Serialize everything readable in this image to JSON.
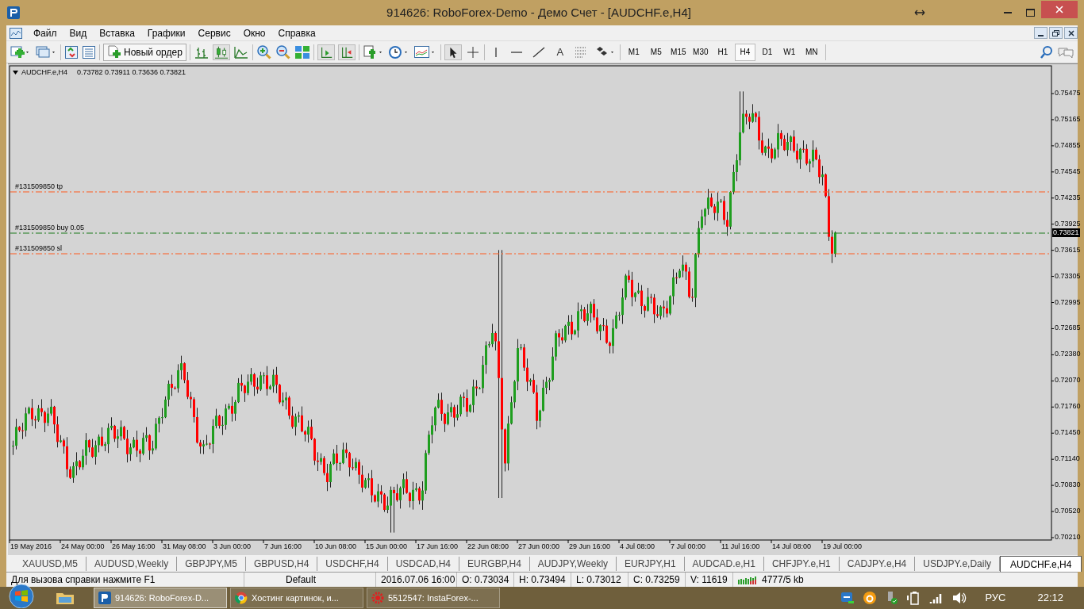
{
  "window": {
    "title": "914626: RoboForex-Demo - Демо Счет - [AUDCHF.e,H4]"
  },
  "menu": [
    "Файл",
    "Вид",
    "Вставка",
    "Графики",
    "Сервис",
    "Окно",
    "Справка"
  ],
  "toolbar": {
    "new_order": "Новый ордер",
    "text_tool": "A",
    "timeframes": [
      {
        "label": "M1",
        "selected": false
      },
      {
        "label": "M5",
        "selected": false
      },
      {
        "label": "M15",
        "selected": false
      },
      {
        "label": "M30",
        "selected": false
      },
      {
        "label": "H1",
        "selected": false
      },
      {
        "label": "H4",
        "selected": true
      },
      {
        "label": "D1",
        "selected": false
      },
      {
        "label": "W1",
        "selected": false
      },
      {
        "label": "MN",
        "selected": false
      }
    ]
  },
  "chart": {
    "symbol": "AUDCHF.e,H4",
    "ohlc": "0.73782 0.73911 0.73636 0.73821",
    "order_lines": [
      {
        "kind": "tp",
        "label": "#131509850 tp"
      },
      {
        "kind": "buy",
        "label": "#131509850 buy 0.05"
      },
      {
        "kind": "sl",
        "label": "#131509850 sl"
      }
    ],
    "price_axis": [
      "0.75475",
      "0.75165",
      "0.74855",
      "0.74545",
      "0.74235",
      "0.73925",
      "0.73615",
      "0.73305",
      "0.72995",
      "0.72685",
      "0.72380",
      "0.72070",
      "0.71760",
      "0.71450",
      "0.71140",
      "0.70830",
      "0.70520",
      "0.70210"
    ],
    "current_price": "0.73821",
    "time_axis": [
      "19 May 2016",
      "24 May 00:00",
      "26 May 16:00",
      "31 May 08:00",
      "3 Jun 00:00",
      "7 Jun 16:00",
      "10 Jun 08:00",
      "15 Jun 00:00",
      "17 Jun 16:00",
      "22 Jun 08:00",
      "27 Jun 00:00",
      "29 Jun 16:00",
      "4 Jul 08:00",
      "7 Jul 00:00",
      "11 Jul 16:00",
      "14 Jul 08:00",
      "19 Jul 00:00"
    ]
  },
  "tabs": [
    {
      "label": "XAUUSD,M5",
      "selected": false
    },
    {
      "label": "AUDUSD,Weekly",
      "selected": false
    },
    {
      "label": "GBPJPY,M5",
      "selected": false
    },
    {
      "label": "GBPUSD,H4",
      "selected": false
    },
    {
      "label": "USDCHF,H4",
      "selected": false
    },
    {
      "label": "USDCAD,H4",
      "selected": false
    },
    {
      "label": "EURGBP,H4",
      "selected": false
    },
    {
      "label": "AUDJPY,Weekly",
      "selected": false
    },
    {
      "label": "EURJPY,H1",
      "selected": false
    },
    {
      "label": "AUDCAD.e,H1",
      "selected": false
    },
    {
      "label": "CHFJPY.e,H1",
      "selected": false
    },
    {
      "label": "CADJPY.e,H4",
      "selected": false
    },
    {
      "label": "USDJPY.e,Daily",
      "selected": false
    },
    {
      "label": "AUDCHF.e,H4",
      "selected": true
    }
  ],
  "status_bar": {
    "help": "Для вызова справки нажмите F1",
    "profile": "Default",
    "time": "2016.07.06 16:00",
    "open": "O: 0.73034",
    "high": "H: 0.73494",
    "low": "L: 0.73012",
    "close": "C: 0.73259",
    "volume": "V: 11619",
    "traffic": "4777/5 kb"
  },
  "taskbar": {
    "items": [
      {
        "kind": "terminal",
        "label": "914626: RoboForex-D...",
        "selected": true
      },
      {
        "kind": "browser",
        "label": "Хостинг картинок, и...",
        "selected": false
      },
      {
        "kind": "insta",
        "label": "5512547: InstaForex-...",
        "selected": false
      }
    ],
    "language": "РУС",
    "clock": "22:12"
  }
}
